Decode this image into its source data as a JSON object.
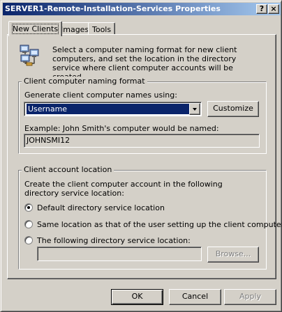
{
  "window": {
    "title": "SERVER1-Remote-Installation-Services Properties",
    "help_glyph": "?",
    "close_glyph": "×"
  },
  "tabs": [
    {
      "label": "New Clients",
      "active": true
    },
    {
      "label": "Images",
      "active": false
    },
    {
      "label": "Tools",
      "active": false
    }
  ],
  "intro": {
    "icon": "network-computers-icon",
    "text": "Select a computer naming format for new client computers, and set the location in the directory service where client computer accounts will be created."
  },
  "naming_group": {
    "legend": "Client computer naming format",
    "generate_label": "Generate client computer names using:",
    "selected_format": "Username",
    "customize_label": "Customize",
    "example_label": "Example: John Smith's computer would be named:",
    "example_value": "JOHNSMI12"
  },
  "location_group": {
    "legend": "Client account location",
    "description": "Create the client computer account in the following directory service location:",
    "options": [
      {
        "label": "Default directory service location",
        "checked": true
      },
      {
        "label": "Same location as that of the user setting up the client computer",
        "checked": false
      },
      {
        "label": "The following directory service location:",
        "checked": false
      }
    ],
    "location_value": "",
    "browse_label": "Browse..."
  },
  "footer": {
    "ok_label": "OK",
    "cancel_label": "Cancel",
    "apply_label": "Apply"
  },
  "colors": {
    "titlebar_start": "#0a246a",
    "titlebar_end": "#a6caf0",
    "face": "#d4d0c8",
    "selection": "#0a246a"
  }
}
